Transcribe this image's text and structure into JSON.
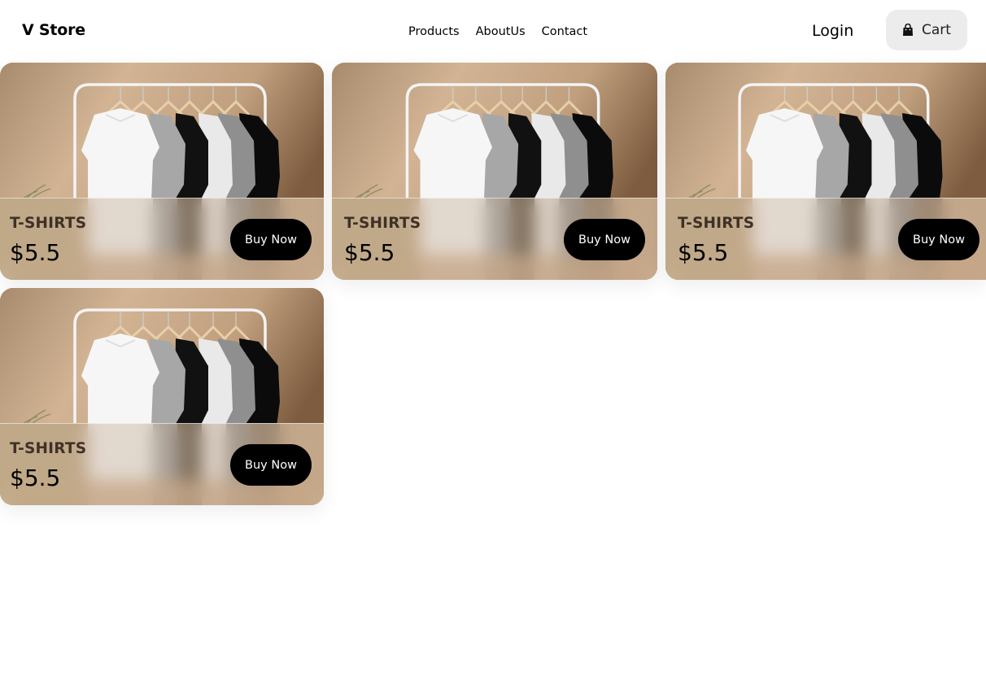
{
  "header": {
    "brand": "V Store",
    "nav": [
      "Products",
      "AboutUs",
      "Contact"
    ],
    "login_label": "Login",
    "cart_label": "Cart"
  },
  "products": [
    {
      "name": "T-SHIRTS",
      "price": "$5.5",
      "cta": "Buy Now",
      "image": "tshirt-rack-photo"
    },
    {
      "name": "T-SHIRTS",
      "price": "$5.5",
      "cta": "Buy Now",
      "image": "tshirt-rack-photo"
    },
    {
      "name": "T-SHIRTS",
      "price": "$5.5",
      "cta": "Buy Now",
      "image": "tshirt-rack-photo"
    },
    {
      "name": "T-SHIRTS",
      "price": "$5.5",
      "cta": "Buy Now",
      "image": "tshirt-rack-photo"
    }
  ],
  "colors": {
    "accent": "#000000",
    "card_bg": "#b9987a",
    "cart_bg": "#ececec"
  }
}
